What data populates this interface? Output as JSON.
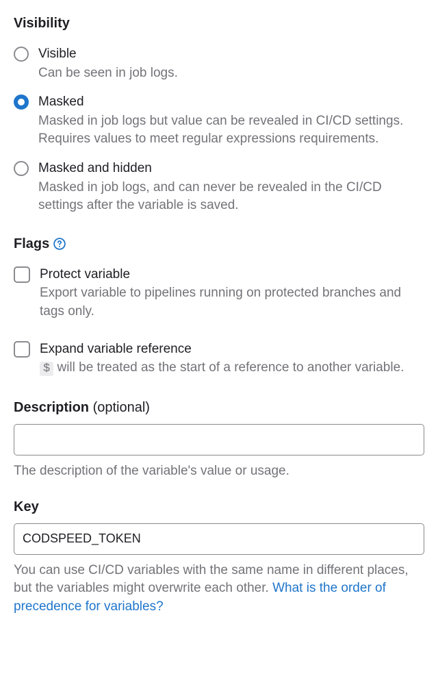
{
  "visibility": {
    "heading": "Visibility",
    "options": [
      {
        "label": "Visible",
        "description": "Can be seen in job logs.",
        "selected": false
      },
      {
        "label": "Masked",
        "description": "Masked in job logs but value can be revealed in CI/CD settings. Requires values to meet regular expressions requirements.",
        "selected": true
      },
      {
        "label": "Masked and hidden",
        "description": "Masked in job logs, and can never be revealed in the CI/CD settings after the variable is saved.",
        "selected": false
      }
    ]
  },
  "flags": {
    "heading": "Flags",
    "protect": {
      "label": "Protect variable",
      "description": "Export variable to pipelines running on protected branches and tags only.",
      "checked": false
    },
    "expand": {
      "label": "Expand variable reference",
      "desc_prefix": "$",
      "desc_rest": " will be treated as the start of a reference to another variable.",
      "checked": false
    }
  },
  "description": {
    "label": "Description",
    "optional": " (optional)",
    "value": "",
    "help": "The description of the variable's value or usage."
  },
  "key": {
    "label": "Key",
    "value": "CODSPEED_TOKEN",
    "help_prefix": "You can use CI/CD variables with the same name in different places, but the variables might overwrite each other. ",
    "help_link": "What is the order of precedence for variables?"
  }
}
